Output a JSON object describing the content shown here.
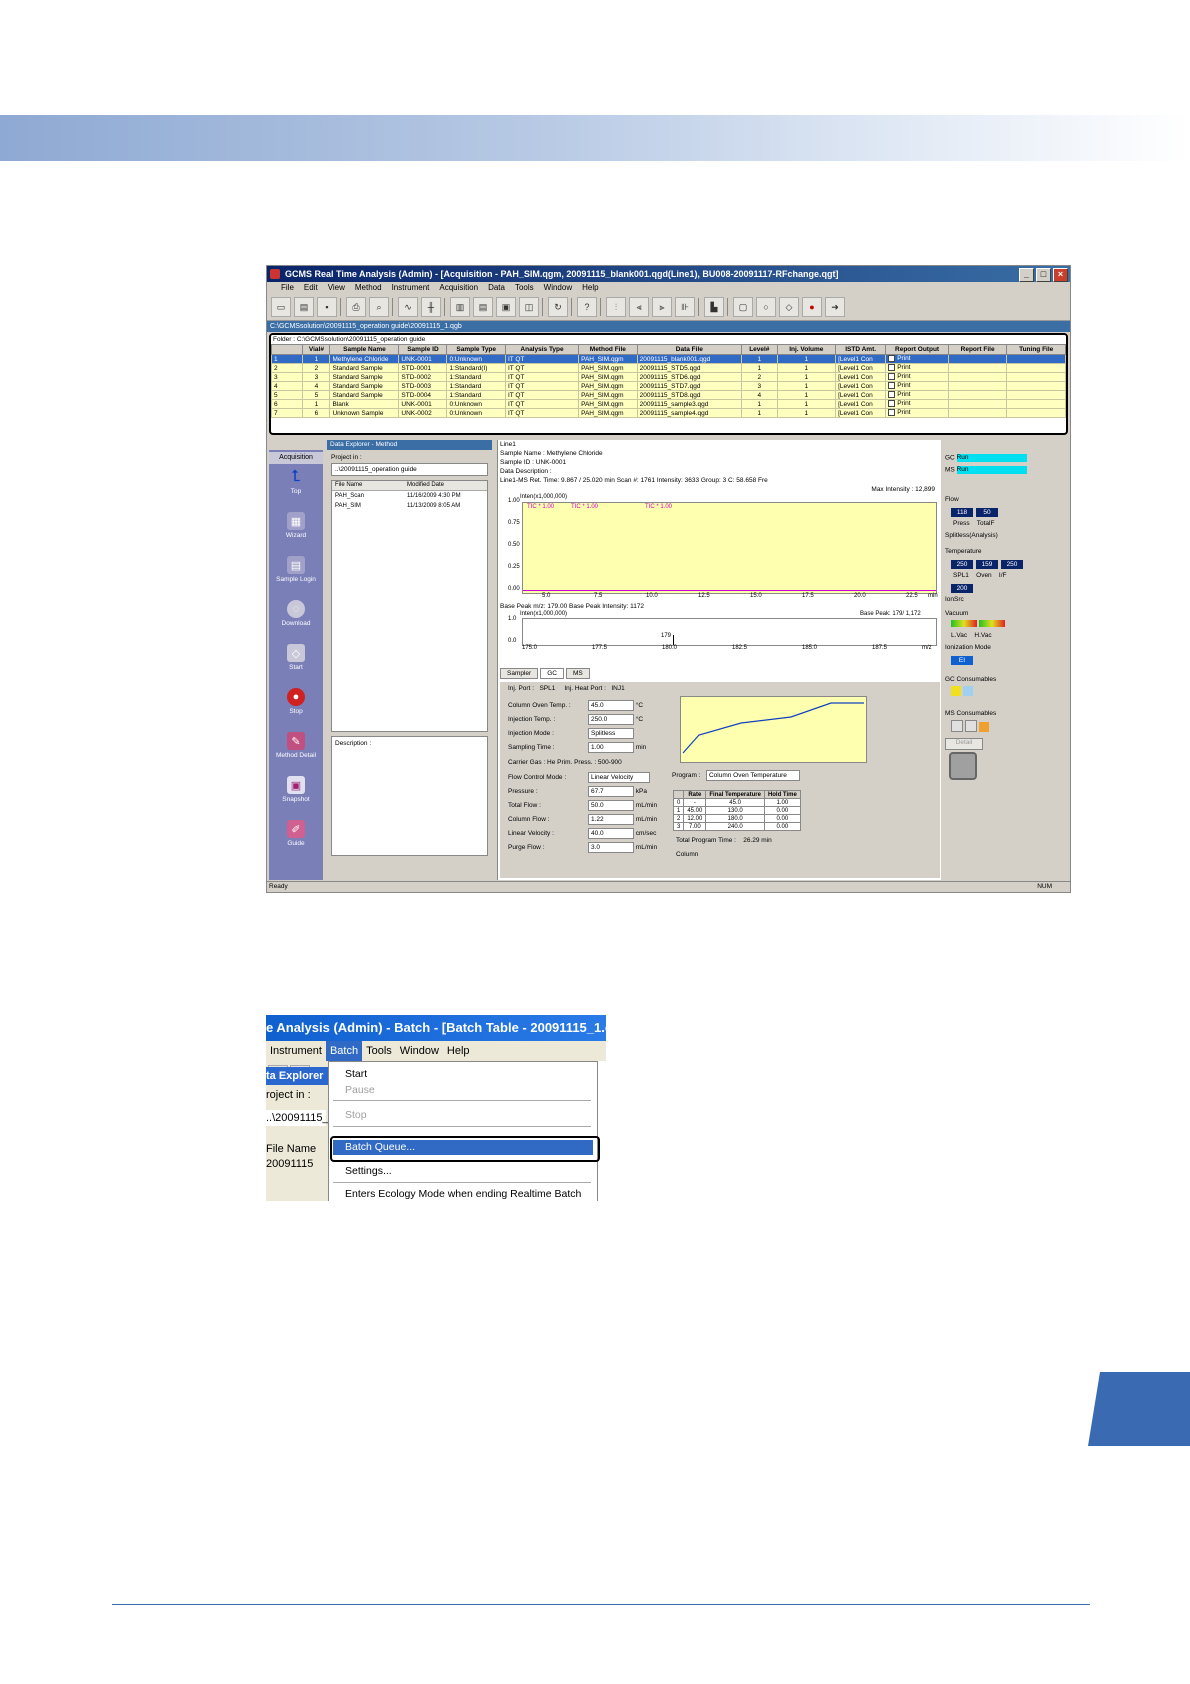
{
  "screenshot1": {
    "title": "GCMS Real Time Analysis (Admin) - [Acquisition - PAH_SIM.qgm, 20091115_blank001.qgd(Line1), BU008-20091117-RFchange.qgt]",
    "menu": [
      "File",
      "Edit",
      "View",
      "Method",
      "Instrument",
      "Acquisition",
      "Data",
      "Tools",
      "Window",
      "Help"
    ],
    "batch_path": "C:\\GCMSsolution\\20091115_operation guide\\20091115_1.qgb",
    "folder_line": "Folder : C:\\GCMSsolution\\20091115_operation guide",
    "batch_headers": [
      "",
      "Vial#",
      "Sample Name",
      "Sample ID",
      "Sample Type",
      "Analysis Type",
      "Method File",
      "Data File",
      "Level#",
      "Inj. Volume",
      "ISTD Amt.",
      "Report Output",
      "Report File",
      "Tuning File"
    ],
    "batch_rows": [
      [
        "1",
        "1",
        "Methylene Chloride",
        "UNK-0001",
        "0:Unknown",
        "IT QT",
        "PAH_SIM.qgm",
        "20091115_blank001.qgd",
        "1",
        "1",
        "[Level1 Con",
        "Print",
        "",
        ""
      ],
      [
        "2",
        "2",
        "Standard Sample",
        "STD-0001",
        "1:Standard(I)",
        "IT QT",
        "PAH_SIM.qgm",
        "20091115_STD5.qgd",
        "1",
        "1",
        "[Level1 Con",
        "Print",
        "",
        ""
      ],
      [
        "3",
        "3",
        "Standard Sample",
        "STD-0002",
        "1:Standard",
        "IT QT",
        "PAH_SIM.qgm",
        "20091115_STD6.qgd",
        "2",
        "1",
        "[Level1 Con",
        "Print",
        "",
        ""
      ],
      [
        "4",
        "4",
        "Standard Sample",
        "STD-0003",
        "1:Standard",
        "IT QT",
        "PAH_SIM.qgm",
        "20091115_STD7.qgd",
        "3",
        "1",
        "[Level1 Con",
        "Print",
        "",
        ""
      ],
      [
        "5",
        "5",
        "Standard Sample",
        "STD-0004",
        "1:Standard",
        "IT QT",
        "PAH_SIM.qgm",
        "20091115_STD8.qgd",
        "4",
        "1",
        "[Level1 Con",
        "Print",
        "",
        ""
      ],
      [
        "6",
        "1",
        "Blank",
        "UNK-0001",
        "0:Unknown",
        "IT QT",
        "PAH_SIM.qgm",
        "20091115_sample3.qgd",
        "1",
        "1",
        "[Level1 Con",
        "Print",
        "",
        ""
      ],
      [
        "7",
        "6",
        "Unknown Sample",
        "UNK-0002",
        "0:Unknown",
        "IT QT",
        "PAH_SIM.qgm",
        "20091115_sample4.qgd",
        "1",
        "1",
        "[Level1 Con",
        "Print",
        "",
        ""
      ]
    ],
    "nav_title": "Acquisition",
    "nav_items": [
      "Top",
      "Wizard",
      "Sample Login",
      "Download",
      "Start",
      "Stop",
      "Method Detail",
      "Snapshot",
      "Guide"
    ],
    "explorer": {
      "title": "Data Explorer - Method",
      "project_label": "Project in :",
      "project_value": "..\\20091115_operation guide",
      "col_file": "File Name",
      "col_date": "Modified Date",
      "files": [
        {
          "name": "PAH_Scan",
          "date": "11/16/2009 4:30 PM"
        },
        {
          "name": "PAH_SIM",
          "date": "11/13/2009 8:05 AM"
        }
      ],
      "description_label": "Description :"
    },
    "center": {
      "line": "Line1",
      "sample_name": "Sample Name : Methylene Chloride",
      "sample_id": "Sample ID : UNK-0001",
      "data_desc": "Data Description :",
      "status": "Line1-MS      Ret. Time: 9.867 / 25.020 min      Scan #: 1761      Intensity: 3633      Group: 3      C: 58.658 Fre",
      "max_intensity": "Max Intensity : 12,899",
      "inten1": "Inten(x1,000,000)",
      "tic_labels": [
        "TIC * 1.00",
        "TIC * 1.00",
        "TIC * 1.00"
      ],
      "y_ticks": [
        "1.00",
        "0.75",
        "0.50",
        "0.25",
        "0.00"
      ],
      "x_ticks": [
        "5.0",
        "7.5",
        "10.0",
        "12.5",
        "15.0",
        "17.5",
        "20.0",
        "22.5"
      ],
      "x_unit": "min",
      "base_peak": "Base Peak m/z: 179.00      Base Peak Intensity: 1172",
      "inten2": "Inten(x1,000,000)",
      "base_peak2": "Base Peak: 179/ 1,172",
      "y2_ticks": [
        "1.0",
        "0.0"
      ],
      "peak2_label": "179",
      "x2_ticks": [
        "175.0",
        "177.5",
        "180.0",
        "182.5",
        "185.0",
        "187.5"
      ],
      "x2_unit": "m/z",
      "tabs": [
        "Sampler",
        "GC",
        "MS"
      ],
      "form": {
        "inj_port_label": "Inj. Port :",
        "inj_port": "SPL1",
        "inj_heat_label": "Inj. Heat Port :",
        "inj_heat": "INJ1",
        "column_oven_label": "Column Oven Temp. :",
        "column_oven": "45.0",
        "injection_temp_label": "Injection Temp. :",
        "injection_temp": "250.0",
        "injection_mode_label": "Injection Mode :",
        "injection_mode": "Splitless",
        "sampling_time_label": "Sampling Time :",
        "sampling_time": "1.00",
        "carrier_gas": "Carrier Gas : He   Prim. Press. : 500-900",
        "flow_mode_label": "Flow Control Mode :",
        "flow_mode": "Linear Velocity",
        "pressure_label": "Pressure :",
        "pressure": "67.7",
        "total_flow_label": "Total Flow :",
        "total_flow": "50.0",
        "column_flow_label": "Column Flow :",
        "column_flow": "1.22",
        "linear_velocity_label": "Linear Velocity :",
        "linear_velocity": "40.0",
        "purge_flow_label": "Purge Flow :",
        "purge_flow": "3.0",
        "program_label": "Program :",
        "program_value": "Column Oven Temperature",
        "oven_headers": [
          "",
          "Rate",
          "Final Temperature",
          "Hold Time"
        ],
        "oven_rows": [
          [
            "0",
            "-",
            "45.0",
            "1.00"
          ],
          [
            "1",
            "45.00",
            "130.0",
            "0.00"
          ],
          [
            "2",
            "12.00",
            "180.0",
            "0.00"
          ],
          [
            "3",
            "7.00",
            "240.0",
            "0.00"
          ]
        ],
        "total_program_label": "Total Program Time :",
        "total_program": "26.29",
        "column_label": "Column"
      }
    },
    "right": {
      "gc_label": "GC",
      "gc_status": "Run",
      "ms_label": "MS",
      "ms_status": "Run",
      "flow_label": "Flow",
      "press_value": "118",
      "totalf_value": "50",
      "press_label": "Press",
      "totalf_label": "TotalF",
      "splitless_label": "Splitless(Analysis)",
      "temperature_label": "Temperature",
      "spl1_value": "250",
      "oven_value": "159",
      "if_value": "250",
      "spl1_label": "SPL1",
      "oven_label": "Oven",
      "if_label": "I/F",
      "ion_src_value": "200",
      "ion_src_label": "IonSrc",
      "vacuum_label": "Vacuum",
      "lvac_label": "L.Vac",
      "hvac_label": "H.Vac",
      "ionization_label": "Ionization Mode",
      "ionization_value": "EI",
      "gc_consumables": "GC Consumables",
      "ms_consumables": "MS Consumables",
      "detail_label": "Detail"
    },
    "status_ready": "Ready",
    "status_num": "NUM"
  },
  "screenshot2": {
    "title": "e Analysis (Admin) - Batch - [Batch Table - 20091115_1.c",
    "menu": [
      "Instrument",
      "Batch",
      "Tools",
      "Window",
      "Help"
    ],
    "explorer_label": "ta Explorer",
    "project_label": "roject in :",
    "project_value": "..\\20091115_",
    "file_name_label": "File Name",
    "file_row": "20091115",
    "items": {
      "start": "Start",
      "pause": "Pause",
      "stop": "Stop",
      "batch_queue": "Batch Queue...",
      "settings": "Settings...",
      "ecology": "Enters Ecology Mode when ending Realtime Batch"
    }
  }
}
